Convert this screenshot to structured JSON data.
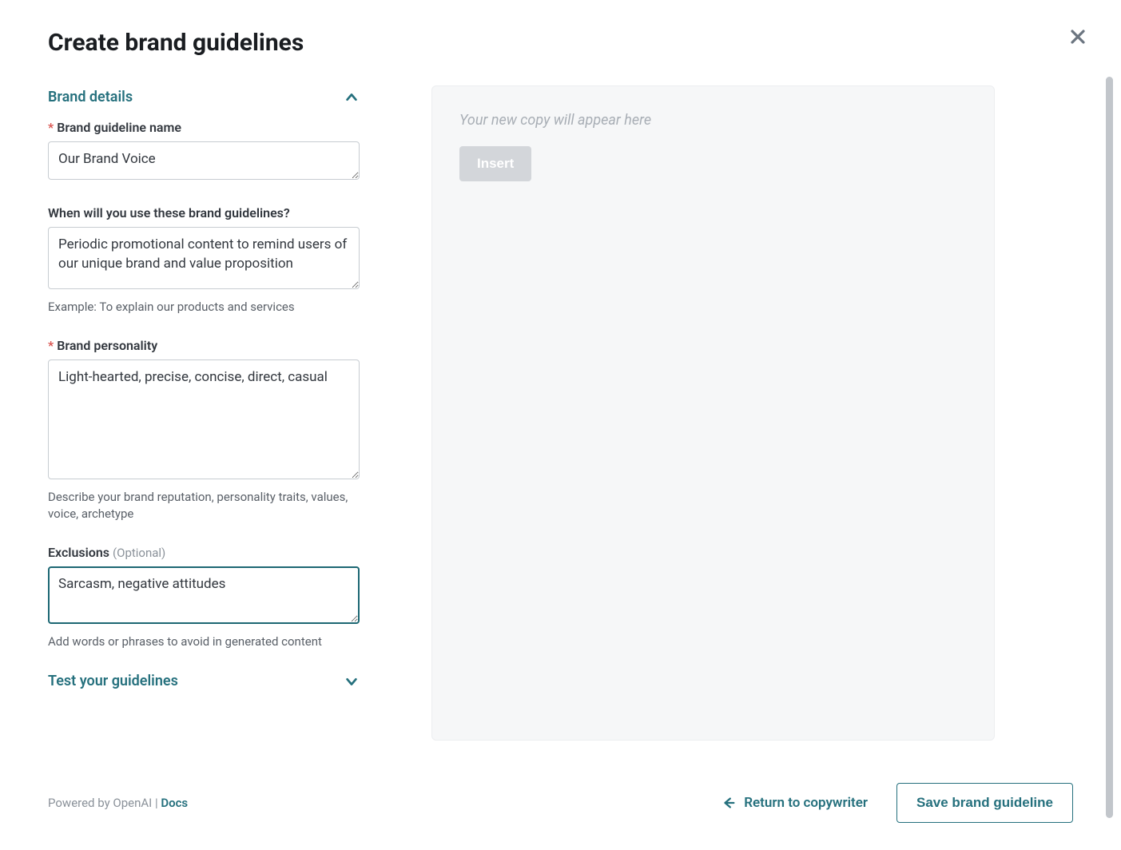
{
  "title": "Create brand guidelines",
  "sections": {
    "brand_details": {
      "label": "Brand details",
      "fields": {
        "name": {
          "label": "Brand guideline name",
          "required": true,
          "value": "Our Brand Voice"
        },
        "when": {
          "label": "When will you use these brand guidelines?",
          "required": false,
          "value": "Periodic promotional content to remind users of our unique brand and value proposition",
          "help": "Example: To explain our products and services"
        },
        "personality": {
          "label": "Brand personality",
          "required": true,
          "value": "Light-hearted, precise, concise, direct, casual",
          "help": "Describe your brand reputation, personality traits, values, voice, archetype"
        },
        "exclusions": {
          "label": "Exclusions",
          "optional_label": "(Optional)",
          "required": false,
          "value": "Sarcasm, negative attitudes",
          "help": "Add words or phrases to avoid in generated content"
        }
      }
    },
    "test": {
      "label": "Test your guidelines"
    }
  },
  "preview": {
    "placeholder": "Your new copy will appear here",
    "insert_label": "Insert"
  },
  "footer": {
    "powered_by": "Powered by OpenAI | ",
    "docs_label": "Docs",
    "return_label": "Return to copywriter",
    "save_label": "Save brand guideline"
  }
}
